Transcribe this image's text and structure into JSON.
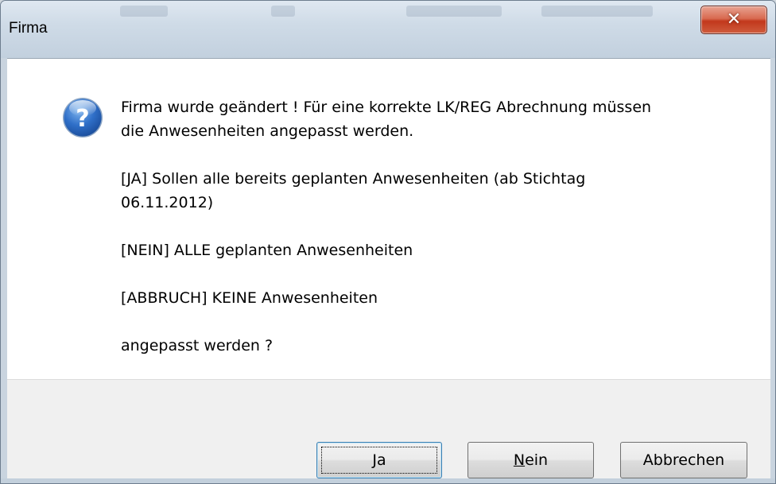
{
  "window": {
    "title": "Firma",
    "close_icon": "close-icon"
  },
  "dialog": {
    "icon": "question-icon",
    "messages": [
      "Firma wurde geändert ! Für eine korrekte LK/REG Abrechnung müssen\ndie Anwesenheiten angepasst werden.",
      "[JA] Sollen alle bereits geplanten Anwesenheiten (ab Stichtag\n06.11.2012)",
      "[NEIN] ALLE geplanten Anwesenheiten",
      "[ABBRUCH] KEINE Anwesenheiten",
      "angepasst werden ?"
    ]
  },
  "buttons": {
    "yes": {
      "mnemonic": "J",
      "rest": "a"
    },
    "no": {
      "mnemonic": "N",
      "rest": "ein"
    },
    "cancel": {
      "label": "Abbrechen"
    }
  },
  "colors": {
    "close_button": "#c2381c",
    "default_button_border": "#3c7fb1",
    "footer_bg": "#f0f0f0"
  }
}
